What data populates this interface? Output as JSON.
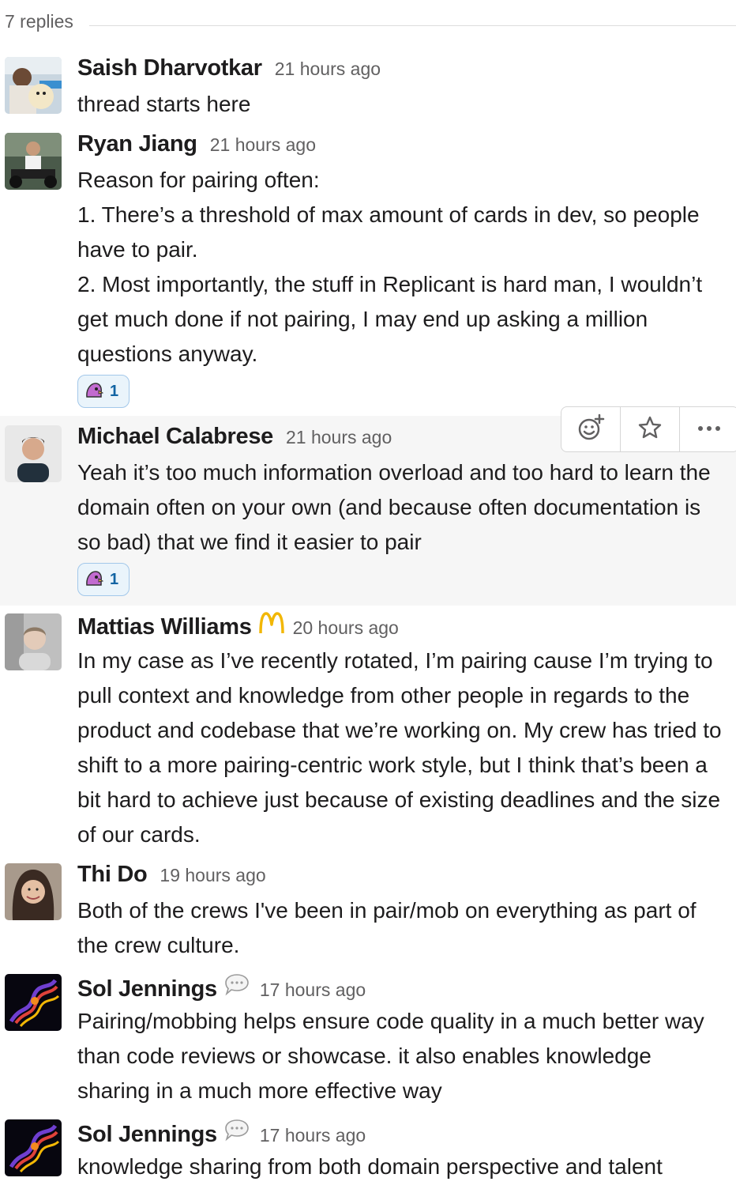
{
  "thread": {
    "replies_label": "7 replies"
  },
  "messages": [
    {
      "author": "Saish Dharvotkar",
      "timestamp": "21 hours ago",
      "lines": [
        "thread starts here"
      ],
      "avatar_icon": "person-with-dog-avatar"
    },
    {
      "author": "Ryan Jiang",
      "timestamp": "21 hours ago",
      "lines": [
        "Reason for pairing often:",
        "1. There’s a threshold of max amount of cards in dev, so people have to pair.",
        "2. Most importantly, the stuff in Replicant is hard man, I wouldn’t get much done if not pairing, I may end up asking a million questions anyway."
      ],
      "reaction": {
        "icon": "party-parrot-icon",
        "count": "1"
      },
      "avatar_icon": "person-on-motorcycle-avatar"
    },
    {
      "author": "Michael Calabrese",
      "timestamp": "21 hours ago",
      "lines": [
        "Yeah it’s too much information overload and too hard to learn the domain often on your own (and because often documentation is so bad) that we find it easier to pair"
      ],
      "reaction": {
        "icon": "party-parrot-icon",
        "count": "1"
      },
      "avatar_icon": "person-portrait-avatar"
    },
    {
      "author": "Mattias Williams",
      "timestamp": "20 hours ago",
      "badge_icon": "mcdonalds-arches-icon",
      "lines": [
        "In my case as I’ve recently rotated, I’m pairing cause I’m trying to pull context and knowledge from other people in regards to the product and codebase that we’re working on. My crew has tried to shift to a more pairing-centric work style, but I think that’s been a bit hard to achieve just because of existing deadlines and the size of our cards."
      ],
      "avatar_icon": "person-portrait-avatar"
    },
    {
      "author": "Thi Do",
      "timestamp": "19 hours ago",
      "lines": [
        "Both of the crews I've been in pair/mob on everything as part of the crew culture."
      ],
      "avatar_icon": "person-selfie-avatar"
    },
    {
      "author": "Sol Jennings",
      "timestamp": "17 hours ago",
      "badge_icon": "speech-bubble-icon",
      "lines": [
        "Pairing/mobbing helps ensure code quality in a much better way than code reviews or showcase. it also enables knowledge sharing in a much more effective way"
      ],
      "avatar_icon": "fractal-art-avatar"
    },
    {
      "author": "Sol Jennings",
      "timestamp": "17 hours ago",
      "badge_icon": "speech-bubble-icon",
      "lines": [
        "knowledge sharing from both domain perspective and talent"
      ],
      "avatar_icon": "fractal-art-avatar"
    }
  ],
  "actions": [
    {
      "icon": "add-reaction-icon"
    },
    {
      "icon": "star-icon"
    },
    {
      "icon": "more-actions-icon"
    }
  ],
  "colors": {
    "text": "#1d1c1d",
    "muted": "#616061",
    "hover_bg": "#f6f6f6",
    "reaction_border": "#a3c8ea",
    "reaction_bg": "#eaf4fb",
    "reaction_count": "#1264a3",
    "badge_gold": "#f2b705"
  }
}
